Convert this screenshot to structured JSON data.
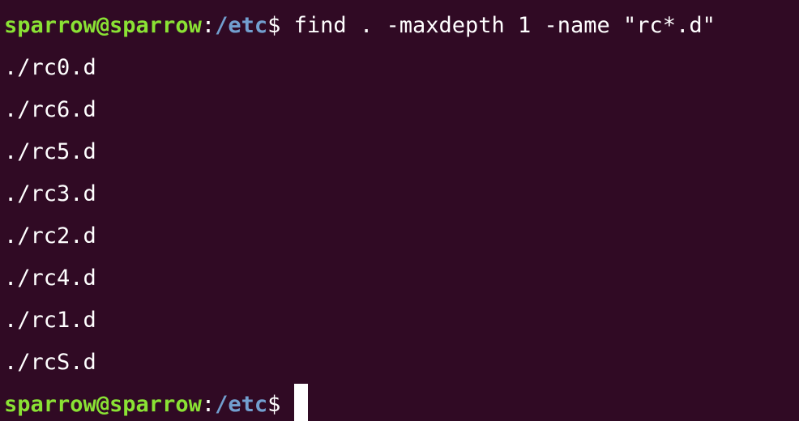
{
  "terminal": {
    "prompt": {
      "user_host": "sparrow@sparrow",
      "separator": ":",
      "cwd": "/etc",
      "symbol": "$"
    },
    "command": " find . -maxdepth 1 -name \"rc*.d\"",
    "output": [
      "./rc0.d",
      "./rc6.d",
      "./rc5.d",
      "./rc3.d",
      "./rc2.d",
      "./rc4.d",
      "./rc1.d",
      "./rcS.d"
    ],
    "colors": {
      "background": "#300a24",
      "user_host": "#8ae234",
      "cwd": "#729fcf",
      "text": "#ffffff"
    }
  }
}
